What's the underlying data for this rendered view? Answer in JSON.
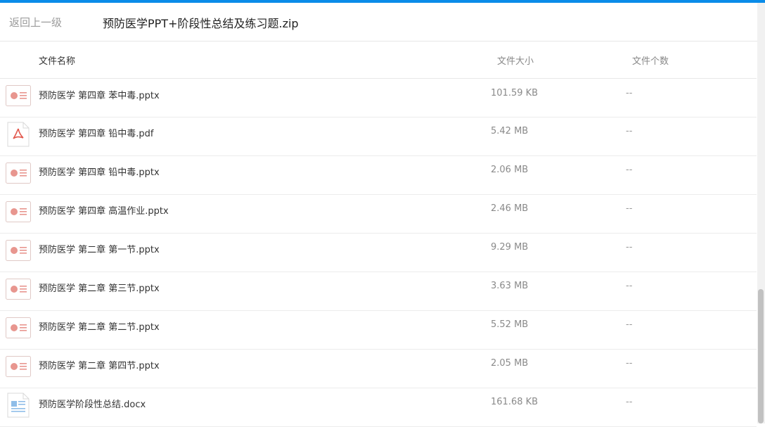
{
  "header": {
    "back_label": "返回上一级",
    "zip_name": "预防医学PPT+阶段性总结及练习题.zip"
  },
  "columns": {
    "name": "文件名称",
    "size": "文件大小",
    "count": "文件个数"
  },
  "files": [
    {
      "name": "预防医学 第四章 苯中毒.pptx",
      "size": "101.59 KB",
      "count": "--",
      "icon": "pptx-icon"
    },
    {
      "name": "预防医学 第四章 铅中毒.pdf",
      "size": "5.42 MB",
      "count": "--",
      "icon": "pdf-icon"
    },
    {
      "name": "预防医学 第四章 铅中毒.pptx",
      "size": "2.06 MB",
      "count": "--",
      "icon": "pptx-icon"
    },
    {
      "name": "预防医学 第四章 高温作业.pptx",
      "size": "2.46 MB",
      "count": "--",
      "icon": "pptx-icon"
    },
    {
      "name": "预防医学 第二章 第一节.pptx",
      "size": "9.29 MB",
      "count": "--",
      "icon": "pptx-icon"
    },
    {
      "name": "预防医学 第二章 第三节.pptx",
      "size": "3.63 MB",
      "count": "--",
      "icon": "pptx-icon"
    },
    {
      "name": "预防医学 第二章 第二节.pptx",
      "size": "5.52 MB",
      "count": "--",
      "icon": "pptx-icon"
    },
    {
      "name": "预防医学 第二章 第四节.pptx",
      "size": "2.05 MB",
      "count": "--",
      "icon": "pptx-icon"
    },
    {
      "name": "预防医学阶段性总结.docx",
      "size": "161.68 KB",
      "count": "--",
      "icon": "docx-icon"
    }
  ],
  "colors": {
    "accent": "#0a8ce9",
    "pptx": "#e8968f",
    "pdf": "#e2574c",
    "docx": "#5b9bd5"
  }
}
